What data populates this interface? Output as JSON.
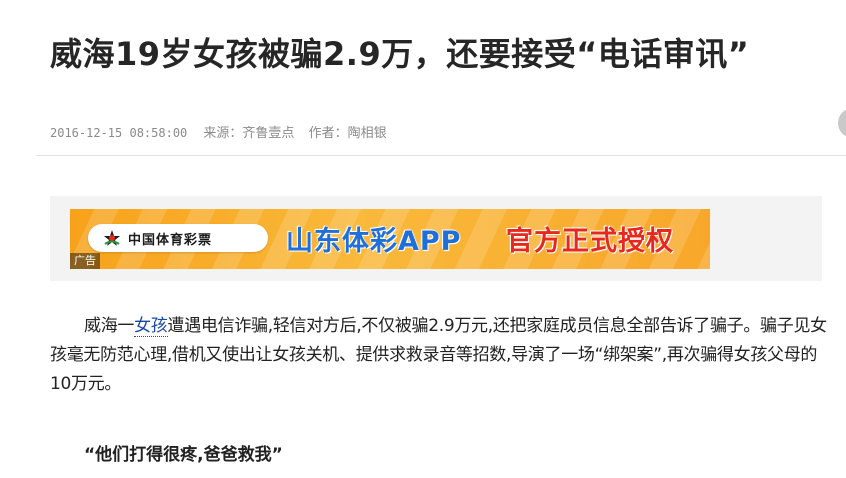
{
  "article": {
    "title": "威海19岁女孩被骗2.9万，还要接受“电话审讯”",
    "meta": {
      "date": "2016-12-15 08:58:00",
      "source": "来源：齐鲁壹点",
      "author": "作者：陶相银"
    },
    "paragraph": {
      "part1": "威海一",
      "link": "女孩",
      "part2": "遭遇电信诈骗,轻信对方后,不仅被骗2.9万元,还把家庭成员信息全部告诉了骗子。骗子见女孩毫无防范心理,借机又使出让女孩关机、提供求救录音等招数,导演了一场“绑架案”,再次骗得女孩父母的10万元。"
    },
    "quote": "“他们打得很疼,爸爸救我”"
  },
  "ad": {
    "brand": "中国体育彩票",
    "headline": "山东体彩APP",
    "slogan": "官方正式授权",
    "tag": "广告"
  },
  "colors": {
    "ad_orange": "#f7a21a",
    "ad_blue": "#1f6fd8",
    "ad_red": "#e6281e",
    "link": "#1a4aa0"
  },
  "icons": {
    "lottery_logo": "lottery-logo-icon",
    "side_button": "scroll-side-icon"
  }
}
